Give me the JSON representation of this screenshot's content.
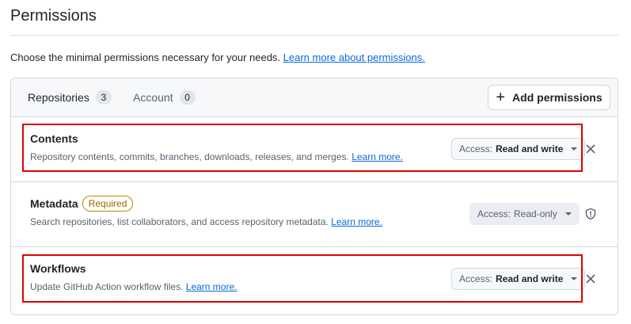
{
  "page": {
    "title": "Permissions",
    "intro_text": "Choose the minimal permissions necessary for your needs. ",
    "intro_link": "Learn more about permissions."
  },
  "tabs": [
    {
      "label": "Repositories",
      "count": "3",
      "active": true
    },
    {
      "label": "Account",
      "count": "0",
      "active": false
    }
  ],
  "add_button": {
    "label": "Add permissions",
    "icon": "plus-icon"
  },
  "permissions": [
    {
      "title": "Contents",
      "badge": "",
      "description": "Repository contents, commits, branches, downloads, releases, and merges. ",
      "link": "Learn more.",
      "access_label": "Access:",
      "access_value": "Read and write",
      "action_icon": "close-icon"
    },
    {
      "title": "Metadata",
      "badge": "Required",
      "description": "Search repositories, list collaborators, and access repository metadata. ",
      "link": "Learn more.",
      "access_label": "Access:",
      "access_value": "Read-only",
      "action_icon": "shield-icon"
    },
    {
      "title": "Workflows",
      "badge": "",
      "description": "Update GitHub Action workflow files. ",
      "link": "Learn more.",
      "access_label": "Access:",
      "access_value": "Read and write",
      "action_icon": "close-icon"
    }
  ],
  "colors": {
    "link": "#0969da",
    "highlight": "#e00000",
    "badge_border": "#bf8700",
    "badge_text": "#9a6700"
  }
}
